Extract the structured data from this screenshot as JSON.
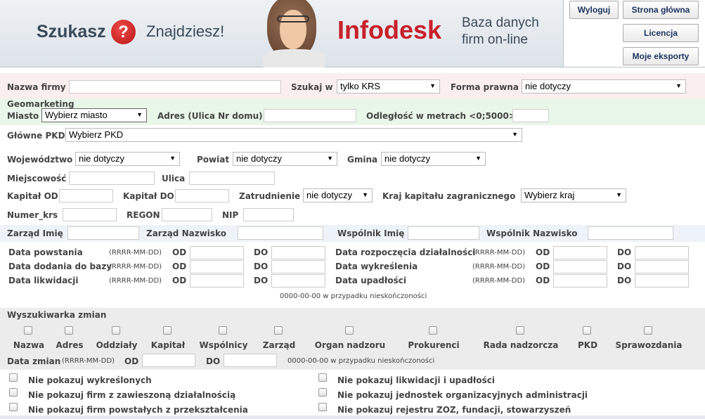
{
  "header": {
    "slogan_left": "Szukasz",
    "slogan_question": "?",
    "slogan_right": "Znajdziesz!",
    "brand": "Infodesk",
    "tagline_line1": "Baza danych",
    "tagline_line2": "firm on-line",
    "buttons": {
      "logout": "Wyloguj",
      "home": "Strona główna",
      "license": "Licencja",
      "exports": "Moje eksporty"
    }
  },
  "form": {
    "company_name_label": "Nazwa firmy",
    "search_in_label": "Szukaj w",
    "search_in_value": "tylko KRS",
    "legal_form_label": "Forma prawna",
    "legal_form_value": "nie dotyczy",
    "geomarketing_label": "Geomarketing",
    "city_label": "Miasto",
    "city_value": "Wybierz miasto",
    "address_label": "Adres (Ulica Nr domu)",
    "distance_label": "Odległość w metrach <0;5000>",
    "pkd_label": "Główne PKD",
    "pkd_value": "Wybierz PKD",
    "voivodeship_label": "Województwo",
    "voivodeship_value": "nie dotyczy",
    "county_label": "Powiat",
    "county_value": "nie dotyczy",
    "commune_label": "Gmina",
    "commune_value": "nie dotyczy",
    "locality_label": "Miejscowość",
    "street_label": "Ulica",
    "capital_from_label": "Kapitał OD",
    "capital_to_label": "Kapitał DO",
    "employment_label": "Zatrudnienie",
    "employment_value": "nie dotyczy",
    "foreign_capital_label": "Kraj kapitału zagranicznego",
    "foreign_capital_value": "Wybierz kraj",
    "krs_label": "Numer_krs",
    "regon_label": "REGON",
    "nip_label": "NIP",
    "board_first_label": "Zarząd Imię",
    "board_last_label": "Zarząd Nazwisko",
    "partner_first_label": "Wspólnik Imię",
    "partner_last_label": "Wspólnik Nazwisko"
  },
  "dates": {
    "format_hint": "(RRRR-MM-DD)",
    "from": "OD",
    "to": "DO",
    "left": [
      "Data powstania",
      "Data dodania do bazy",
      "Data likwidacji"
    ],
    "right": [
      "Data rozpoczęcia działalności",
      "Data wykreślenia",
      "Data upadłości"
    ],
    "note": "0000-00-00 w przypadku nieskończoności"
  },
  "changes": {
    "title": "Wyszukiwarka zmian",
    "items": [
      "Nazwa",
      "Adres",
      "Oddziały",
      "Kapitał",
      "Wspólnicy",
      "Zarząd",
      "Organ nadzoru",
      "Prokurenci",
      "Rada nadzorcza",
      "PKD",
      "Sprawozdania"
    ],
    "date_label": "Data zmian",
    "format_hint": "(RRRR-MM-DD)",
    "from": "OD",
    "to": "DO",
    "note": "0000-00-00 w przypadku nieskończoności"
  },
  "filters": {
    "left": [
      "Nie pokazuj wykreślonych",
      "Nie pokazuj firm z zawieszoną działalnością",
      "Nie pokazuj firm powstałych z przekształcenia"
    ],
    "right": [
      "Nie pokazuj likwidacji i upadłości",
      "Nie pokazuj jednostek organizacyjnych administracji",
      "Nie pokazuj rejestru ZOZ, fundacji, stowarzyszeń"
    ]
  },
  "colors": {
    "brand_red": "#c8202b",
    "bg_pink": "#fbeeee",
    "bg_green": "#e9f7e9",
    "bg_blue": "#eef3fa",
    "bg_gray": "#ececec",
    "button_text": "#1b3560"
  }
}
